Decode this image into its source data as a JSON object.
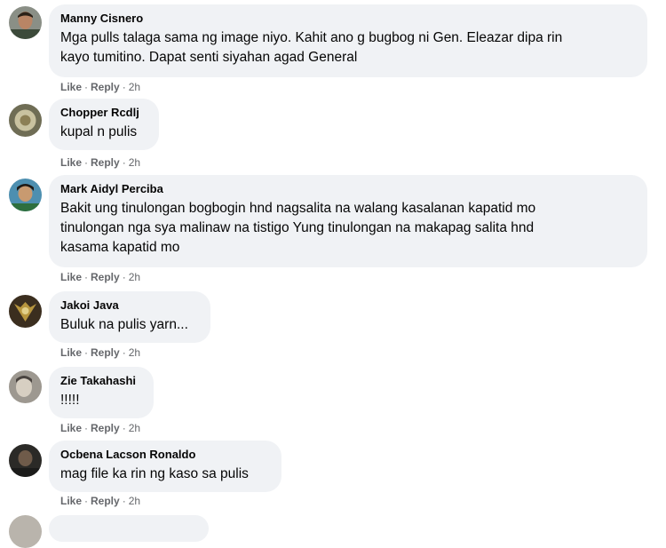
{
  "comments": [
    {
      "author": "Manny Cisnero",
      "lines": [
        "Mga pulls talaga sama ng image niyo. Kahit ano g bugbog ni Gen. Eleazar dipa rin",
        "kayo tumitino. Dapat senti siyahan agad General"
      ],
      "like": "Like",
      "reply": "Reply",
      "time": "2h"
    },
    {
      "author": "Chopper Rcdlj",
      "lines": [
        "kupal n pulis"
      ],
      "like": "Like",
      "reply": "Reply",
      "time": "2h"
    },
    {
      "author": "Mark Aidyl Perciba",
      "lines": [
        "Bakit ung tinulongan bogbogin hnd nagsalita na walang kasalanan kapatid mo",
        "tinulongan nga sya malinaw na tistigo Yung tinulongan na makapag salita hnd",
        "kasama kapatid mo"
      ],
      "like": "Like",
      "reply": "Reply",
      "time": "2h"
    },
    {
      "author": "Jakoi Java",
      "lines": [
        "Buluk na pulis yarn..."
      ],
      "like": "Like",
      "reply": "Reply",
      "time": "2h"
    },
    {
      "author": "Zie Takahashi",
      "lines": [
        "!!!!!"
      ],
      "like": "Like",
      "reply": "Reply",
      "time": "2h"
    },
    {
      "author": "Ocbena Lacson Ronaldo",
      "lines": [
        "mag file ka rin ng kaso sa pulis"
      ],
      "like": "Like",
      "reply": "Reply",
      "time": "2h"
    }
  ],
  "separator": "·"
}
